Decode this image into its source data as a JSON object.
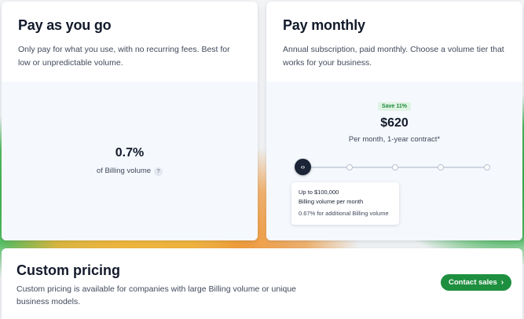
{
  "payg": {
    "title": "Pay as you go",
    "description": "Only pay for what you use, with no recurring fees. Best for low or unpredictable volume.",
    "rate": "0.7%",
    "rate_label": "of Billing volume",
    "help_icon": "?"
  },
  "monthly": {
    "title": "Pay monthly",
    "description": "Annual subscription, paid monthly. Choose a volume tier that works for your business.",
    "badge": "Save 11%",
    "price": "$620",
    "price_label": "Per month, 1-year contract*",
    "slider": {
      "selected_index": 0,
      "stop_count": 5,
      "thumb_icon": "‹›"
    },
    "tier": {
      "line1": "Up to $100,000",
      "line2": "Billing volume per month",
      "line3": "0.67% for additional Billing volume"
    }
  },
  "custom": {
    "title": "Custom pricing",
    "description": "Custom pricing is available for companies with large Billing volume or unique business models.",
    "button_label": "Contact sales",
    "button_icon": "›"
  },
  "colors": {
    "accent_green": "#1e8f3f",
    "badge_bg": "#dff3e3",
    "thumb": "#1b2537"
  }
}
